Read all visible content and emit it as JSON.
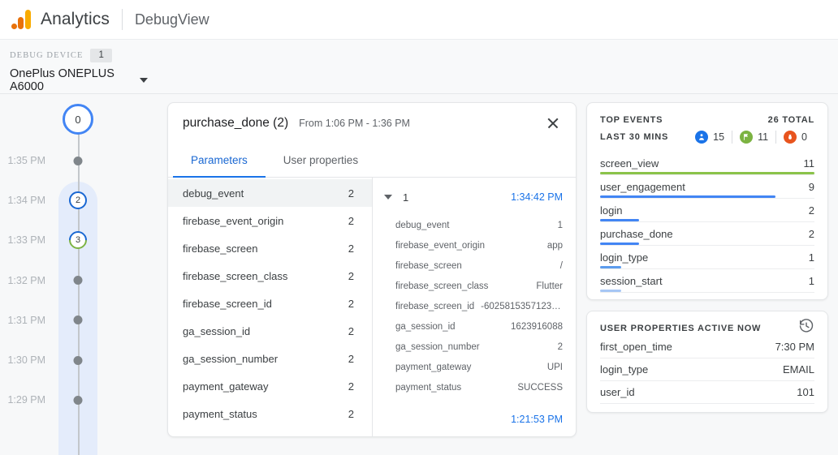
{
  "header": {
    "logo_icon": "analytics-logo-icon",
    "product": "Analytics",
    "section": "DebugView"
  },
  "device_selector": {
    "label": "DEBUG DEVICE",
    "count": "1",
    "selected": "OnePlus ONEPLUS A6000",
    "caret_icon": "chevron-down-icon"
  },
  "timeline": {
    "top_node": "0",
    "rows": [
      {
        "time": "1:35 PM",
        "marker": "dot",
        "value": ""
      },
      {
        "time": "1:34 PM",
        "marker": "circle",
        "value": "2"
      },
      {
        "time": "1:33 PM",
        "marker": "mixed",
        "value": "3"
      },
      {
        "time": "1:32 PM",
        "marker": "dot",
        "value": ""
      },
      {
        "time": "1:31 PM",
        "marker": "dot",
        "value": ""
      },
      {
        "time": "1:30 PM",
        "marker": "dot",
        "value": ""
      },
      {
        "time": "1:29 PM",
        "marker": "dot",
        "value": ""
      }
    ]
  },
  "event_card": {
    "event_name": "purchase_done (2)",
    "time_range": "From 1:06 PM - 1:36 PM",
    "close_icon": "close-icon",
    "tabs": [
      {
        "label": "Parameters",
        "active": true
      },
      {
        "label": "User properties",
        "active": false
      }
    ],
    "parameters": [
      {
        "name": "debug_event",
        "count": "2",
        "selected": true
      },
      {
        "name": "firebase_event_origin",
        "count": "2",
        "selected": false
      },
      {
        "name": "firebase_screen",
        "count": "2",
        "selected": false
      },
      {
        "name": "firebase_screen_class",
        "count": "2",
        "selected": false
      },
      {
        "name": "firebase_screen_id",
        "count": "2",
        "selected": false
      },
      {
        "name": "ga_session_id",
        "count": "2",
        "selected": false
      },
      {
        "name": "ga_session_number",
        "count": "2",
        "selected": false
      },
      {
        "name": "payment_gateway",
        "count": "2",
        "selected": false
      },
      {
        "name": "payment_status",
        "count": "2",
        "selected": false
      }
    ],
    "detail": {
      "expand_icon": "triangle-down-icon",
      "index": "1",
      "timestamp": "1:34:42 PM",
      "rows": [
        {
          "name": "debug_event",
          "value": "1"
        },
        {
          "name": "firebase_event_origin",
          "value": "app"
        },
        {
          "name": "firebase_screen",
          "value": "/"
        },
        {
          "name": "firebase_screen_class",
          "value": "Flutter"
        },
        {
          "name": "firebase_screen_id",
          "value": "-6025815357123331…"
        },
        {
          "name": "ga_session_id",
          "value": "1623916088"
        },
        {
          "name": "ga_session_number",
          "value": "2"
        },
        {
          "name": "payment_gateway",
          "value": "UPI"
        },
        {
          "name": "payment_status",
          "value": "SUCCESS"
        }
      ],
      "footer_timestamp": "1:21:53 PM"
    }
  },
  "top_events": {
    "title": "TOP EVENTS",
    "total": "26 TOTAL",
    "subtitle": "LAST 30 MINS",
    "metrics": [
      {
        "icon": "users-icon",
        "value": "15",
        "color": "#1a73e8"
      },
      {
        "icon": "conversion-icon",
        "value": "11",
        "color": "#7cb342"
      },
      {
        "icon": "bug-icon",
        "value": "0",
        "color": "#e8541e"
      }
    ],
    "items": [
      {
        "name": "screen_view",
        "count": "11",
        "bar_pct": 100,
        "color": "#8bc34a"
      },
      {
        "name": "user_engagement",
        "count": "9",
        "bar_pct": 82,
        "color": "#4285f4"
      },
      {
        "name": "login",
        "count": "2",
        "bar_pct": 18,
        "color": "#4285f4"
      },
      {
        "name": "purchase_done",
        "count": "2",
        "bar_pct": 18,
        "color": "#4285f4"
      },
      {
        "name": "login_type",
        "count": "1",
        "bar_pct": 10,
        "color": "#5c9ced"
      },
      {
        "name": "session_start",
        "count": "1",
        "bar_pct": 10,
        "color": "#a7c7f5"
      }
    ]
  },
  "user_properties": {
    "title": "USER PROPERTIES ACTIVE NOW",
    "history_icon": "history-icon",
    "items": [
      {
        "name": "first_open_time",
        "value": "7:30 PM"
      },
      {
        "name": "login_type",
        "value": "EMAIL"
      },
      {
        "name": "user_id",
        "value": "101"
      }
    ]
  }
}
